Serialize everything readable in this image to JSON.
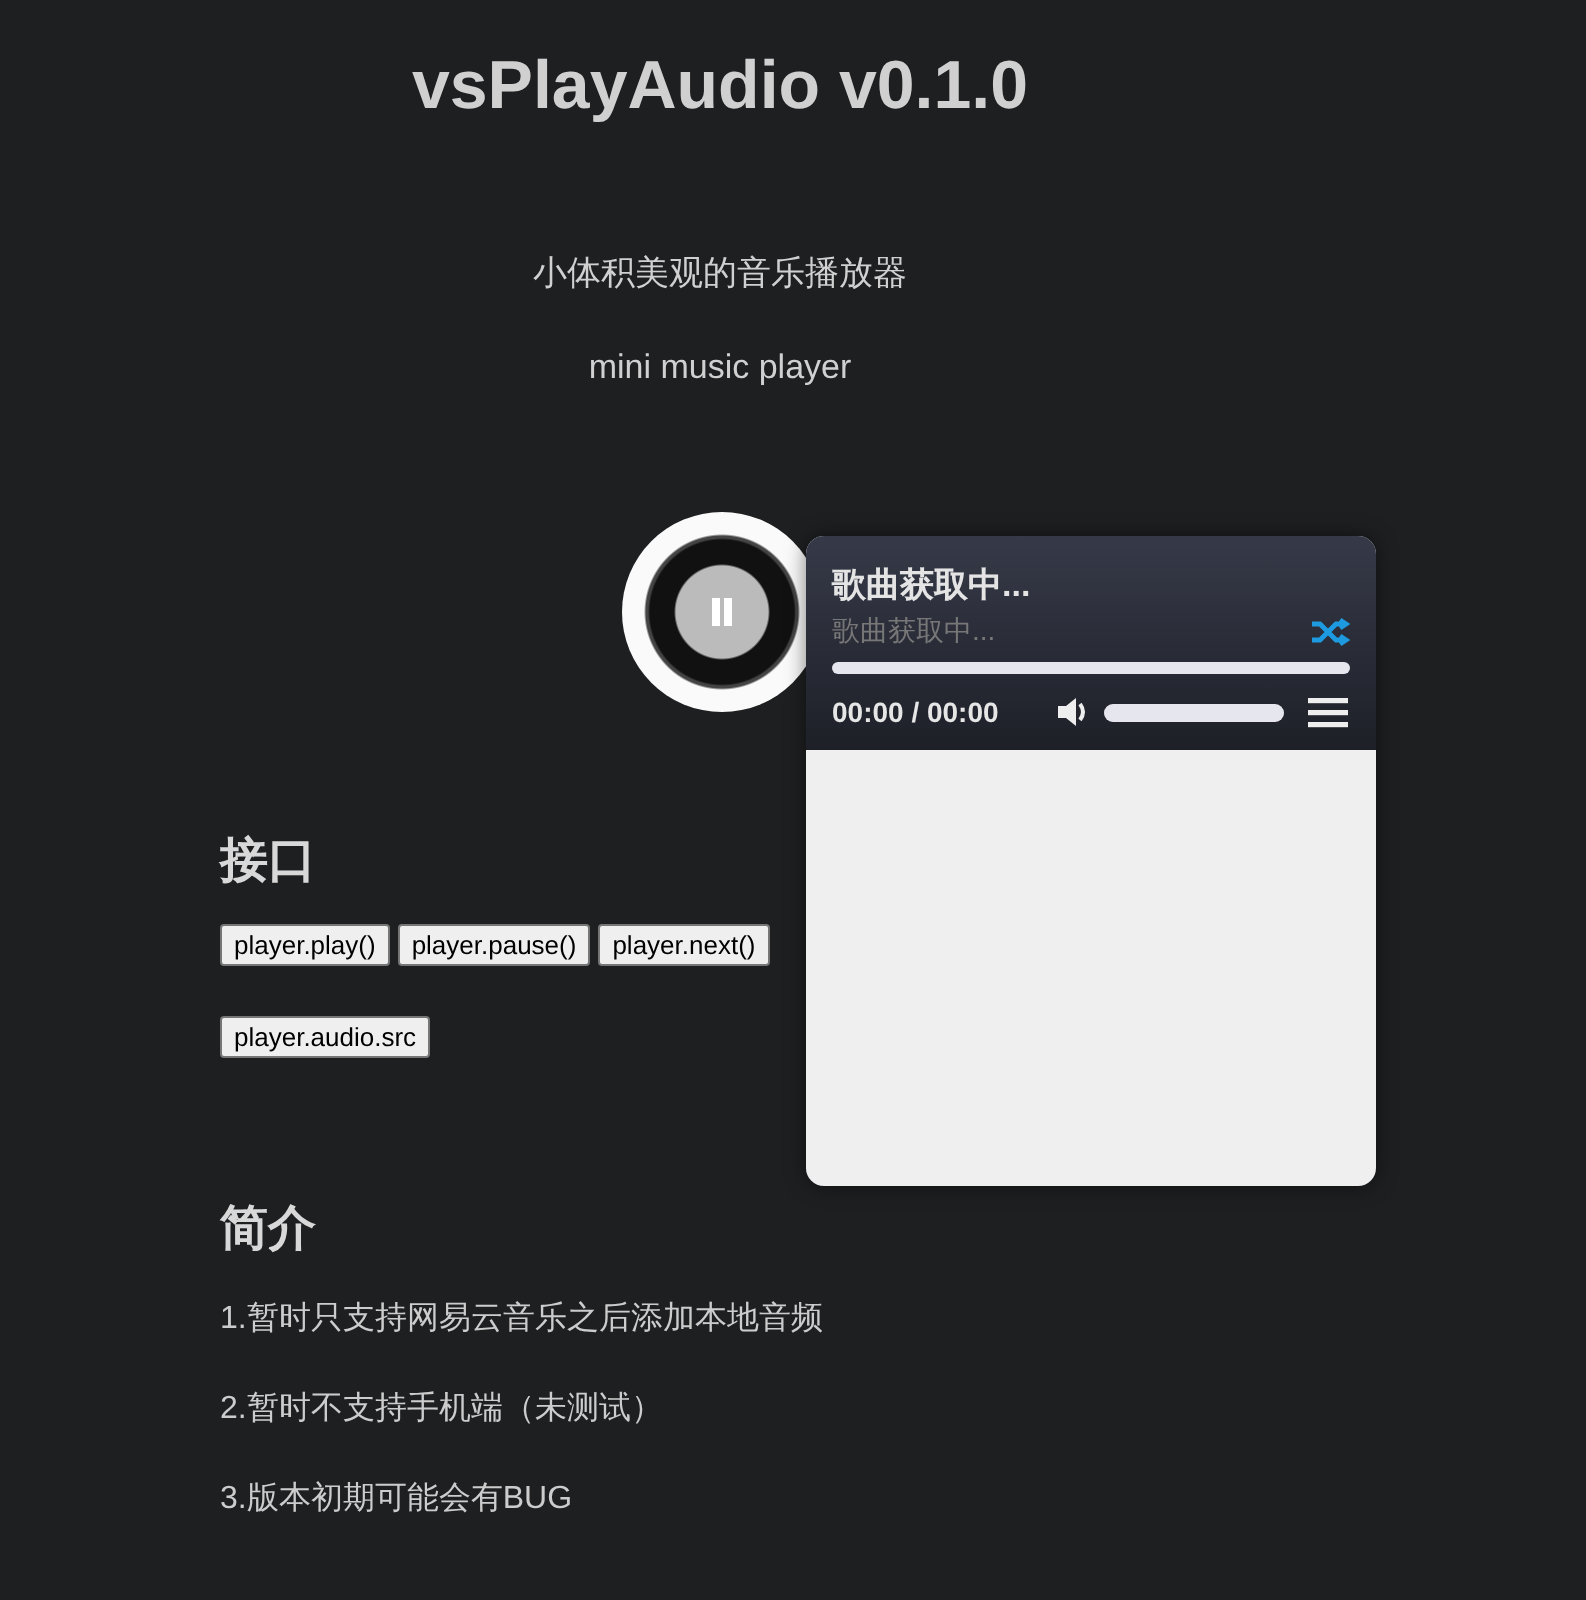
{
  "title": "vsPlayAudio v0.1.0",
  "subtitles": [
    "小体积美观的音乐播放器",
    "mini music player"
  ],
  "sections": [
    {
      "heading": "接口",
      "button_rows": [
        [
          "player.play()",
          "player.pause()",
          "player.next()"
        ],
        [
          "player.audio.src"
        ]
      ]
    },
    {
      "heading": "简介",
      "paragraphs": [
        "1.暂时只支持网易云音乐之后添加本地音频",
        "2.暂时不支持手机端（未测试）",
        "3.版本初期可能会有BUG"
      ]
    }
  ],
  "player": {
    "playing": true,
    "song_title": "歌曲获取中...",
    "artist": "歌曲获取中...",
    "shuffle": true,
    "time": "00:00 / 00:00",
    "volume": {
      "level": 1
    }
  }
}
